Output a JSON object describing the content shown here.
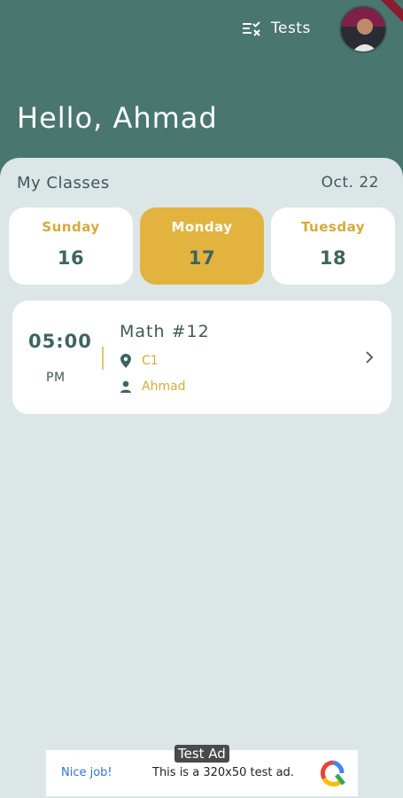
{
  "header": {
    "tests_label": "Tests",
    "greeting": "Hello, Ahmad"
  },
  "classes": {
    "section_title": "My Classes",
    "date": "Oct. 22",
    "days": [
      {
        "name": "Sunday",
        "num": "16",
        "active": false
      },
      {
        "name": "Monday",
        "num": "17",
        "active": true
      },
      {
        "name": "Tuesday",
        "num": "18",
        "active": false
      }
    ],
    "items": [
      {
        "time": "05:00",
        "ampm": "PM",
        "title": "Math #12",
        "location": "C1",
        "teacher": "Ahmad"
      }
    ]
  },
  "ad": {
    "tag": "Test Ad",
    "nice": "Nice job!",
    "text": "This is a 320x50 test ad."
  },
  "colors": {
    "header": "#4a7670",
    "accent": "#e3b33f",
    "background": "#dce6e6",
    "text_dark": "#3d6560"
  }
}
